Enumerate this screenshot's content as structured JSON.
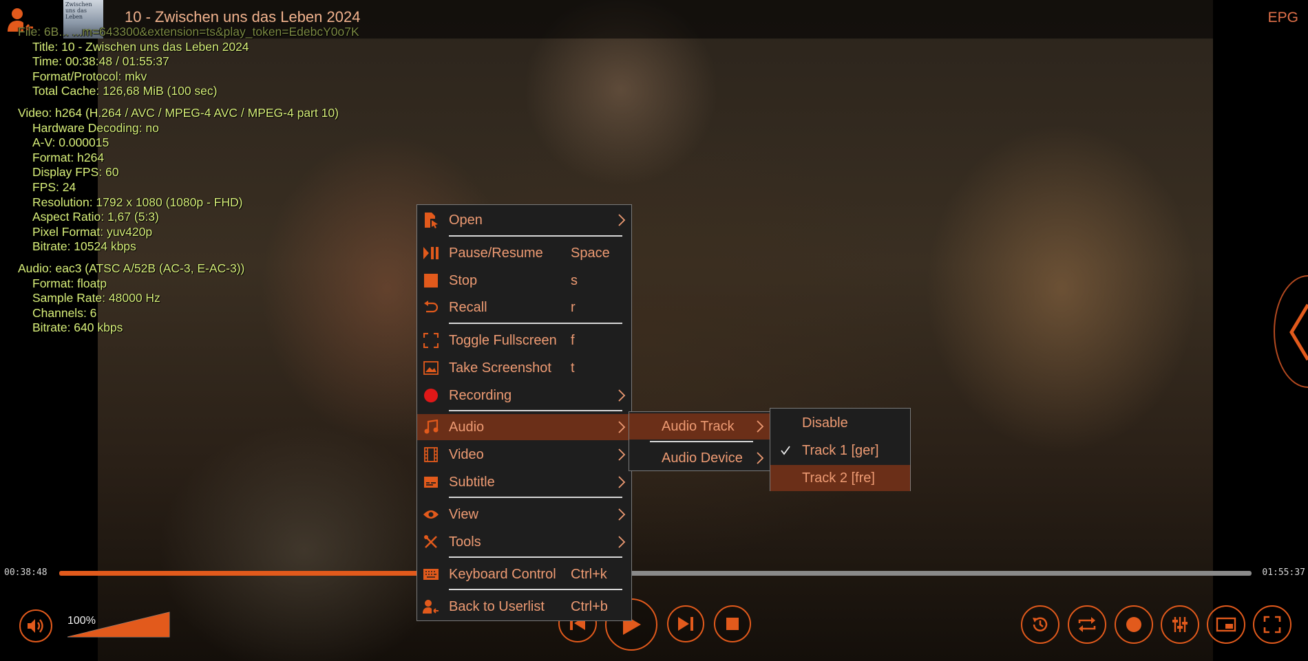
{
  "header": {
    "title": "10 - Zwischen uns das Leben 2024",
    "poster_text": "Zwischen uns das Leben",
    "epg_label": "EPG"
  },
  "stats": {
    "file_line": "File: 6B... ...m=643300&extension=ts&play_token=EdebcY0o7K",
    "title_line": "Title: 10 - Zwischen uns das Leben 2024",
    "time_line": "Time: 00:38:48 / 01:55:37",
    "format_line": "Format/Protocol: mkv",
    "cache_line": "Total Cache: 126,68 MiB (100 sec)",
    "video_line": "Video: h264 (H.264 / AVC / MPEG-4 AVC / MPEG-4 part 10)",
    "hwdec_line": "Hardware Decoding: no",
    "av_line": "A-V: 0.000015",
    "vformat_line": "Format: h264",
    "dfps_line": "Display FPS: 60",
    "fps_line": "FPS: 24",
    "res_line": "Resolution: 1792 x 1080 (1080p - FHD)",
    "aspect_line": "Aspect Ratio: 1,67 (5:3)",
    "pixfmt_line": "Pixel Format: yuv420p",
    "vbitrate_line": "Bitrate: 10524 kbps",
    "audio_line": "Audio: eac3 (ATSC A/52B (AC-3, E-AC-3))",
    "aformat_line": "Format: floatp",
    "srate_line": "Sample Rate: 48000 Hz",
    "channels_line": "Channels: 6",
    "abitrate_line": "Bitrate: 640 kbps"
  },
  "player": {
    "time_current": "00:38:48",
    "time_total": "01:55:37",
    "progress": 0.3356,
    "volume_label": "100%",
    "volume_level": 1.0
  },
  "menu": {
    "items": [
      {
        "label": "Open",
        "shortcut": "",
        "icon": "open-file-icon"
      },
      {
        "label": "Pause/Resume",
        "shortcut": "Space",
        "icon": "pause-play-icon"
      },
      {
        "label": "Stop",
        "shortcut": "s",
        "icon": "stop-icon"
      },
      {
        "label": "Recall",
        "shortcut": "r",
        "icon": "recall-icon"
      },
      {
        "label": "Toggle Fullscreen",
        "shortcut": "f",
        "icon": "fullscreen-icon"
      },
      {
        "label": "Take Screenshot",
        "shortcut": "t",
        "icon": "screenshot-icon"
      },
      {
        "label": "Recording",
        "shortcut": "",
        "icon": "record-icon"
      },
      {
        "label": "Audio",
        "shortcut": "",
        "icon": "music-note-icon"
      },
      {
        "label": "Video",
        "shortcut": "",
        "icon": "film-icon"
      },
      {
        "label": "Subtitle",
        "shortcut": "",
        "icon": "subtitle-icon"
      },
      {
        "label": "View",
        "shortcut": "",
        "icon": "eye-icon"
      },
      {
        "label": "Tools",
        "shortcut": "",
        "icon": "tools-icon"
      },
      {
        "label": "Keyboard Control",
        "shortcut": "Ctrl+k",
        "icon": "keyboard-icon"
      },
      {
        "label": "Back to Userlist",
        "shortcut": "Ctrl+b",
        "icon": "back-to-userlist-icon"
      }
    ]
  },
  "audio_menu": {
    "items": [
      {
        "label": "Audio Track"
      },
      {
        "label": "Audio Device"
      }
    ]
  },
  "track_menu": {
    "items": [
      {
        "label": "Disable",
        "checked": false
      },
      {
        "label": "Track 1 [ger]",
        "checked": true
      },
      {
        "label": "Track 2 [fre]",
        "checked": false
      }
    ]
  },
  "colors": {
    "accent": "#e25a1c",
    "menu_text": "#ee9b73",
    "menu_highlight": "#6b2f18",
    "stats_text": "#d9f07a"
  }
}
